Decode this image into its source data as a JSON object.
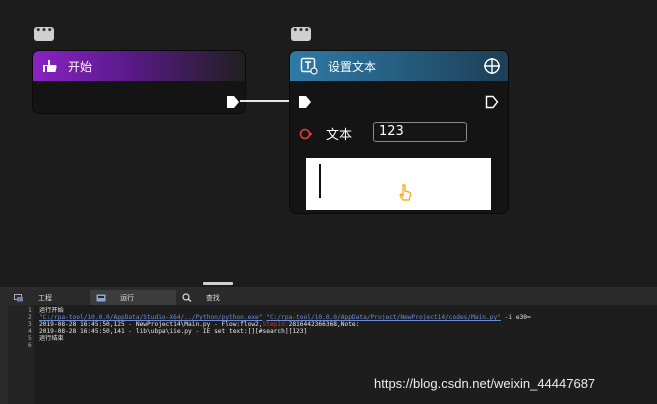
{
  "canvas": {
    "start_node": {
      "title": "开始",
      "comment_icon": "comment-icon",
      "icon": "hand-pointer-icon"
    },
    "settext_node": {
      "title": "设置文本",
      "icon": "text-tool-icon",
      "target_icon": "crosshair-icon",
      "comment_icon": "comment-icon",
      "param_label": "文本",
      "param_value": "123"
    }
  },
  "panel": {
    "tabs": [
      {
        "label": "工程",
        "icon": "project-icon"
      },
      {
        "label": "运行",
        "icon": "run-icon"
      },
      {
        "label": "查找",
        "icon": "search-icon"
      }
    ],
    "console_lines": [
      {
        "n": "1",
        "parts": [
          {
            "t": "运行开始",
            "c": "normal"
          }
        ]
      },
      {
        "n": "2",
        "parts": [
          {
            "t": "\"C:/rpa-tool/10.0.0/AppData/Studio-X64/../Python/python.exe\"",
            "c": "link"
          },
          {
            "t": " ",
            "c": "normal"
          },
          {
            "t": "\"C:/rpa-tool/10.0.0/AppData/Project/NewProject14/codes/Main.py\"",
            "c": "link"
          },
          {
            "t": " -i e30=",
            "c": "normal"
          }
        ]
      },
      {
        "n": "3",
        "parts": [
          {
            "t": "2019-08-28 16:45:50,125 - NewProject14\\Main.py - Flow:flow2,",
            "c": "normal"
          },
          {
            "t": "StepId:",
            "c": "red"
          },
          {
            "t": "2816442366368,Note:",
            "c": "normal"
          }
        ]
      },
      {
        "n": "4",
        "parts": [
          {
            "t": "2019-08-28 16:45:50,141 - lib\\ubpa\\iie.py - IE set text:[][#search][123]",
            "c": "normal"
          }
        ]
      },
      {
        "n": "5",
        "parts": [
          {
            "t": "运行结束",
            "c": "normal"
          }
        ]
      },
      {
        "n": "6",
        "parts": []
      }
    ]
  },
  "watermark": "https://blog.csdn.net/weixin_44447687",
  "colors": {
    "start_header": "#7a1fb5",
    "settext_header": "#2e6f97",
    "wire": "#e6e6e6",
    "param_pin": "#e23a3a",
    "cursor": "#f3a400"
  }
}
